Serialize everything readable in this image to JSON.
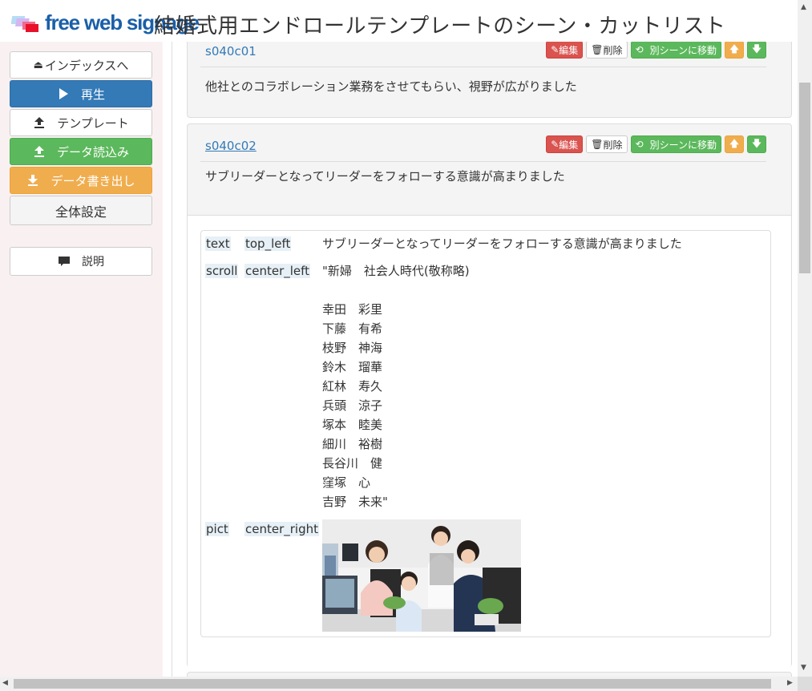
{
  "header": {
    "logo_text": "free web signage",
    "title": "結婚式用エンドロールテンプレートのシーン・カットリスト"
  },
  "sidebar": {
    "index": "インデックスへ",
    "play": "再生",
    "template": "テンプレート",
    "import": "データ読込み",
    "export": "データ書き出し",
    "settings": "全体設定",
    "help": "説明"
  },
  "cut_buttons": {
    "edit": "編集",
    "delete": "削除",
    "move": "別シーンに移動"
  },
  "cuts": [
    {
      "id": "s040c01",
      "text": "他社とのコラボレーション業務をさせてもらい、視野が広がりました"
    },
    {
      "id": "s040c02",
      "text": "サブリーダーとなってリーダーをフォローする意識が高まりました"
    }
  ],
  "detail": {
    "items": [
      {
        "type": "text",
        "position": "top_left",
        "value": "サブリーダーとなってリーダーをフォローする意識が高まりました"
      },
      {
        "type": "scroll",
        "position": "center_left",
        "lines": [
          "\"新婦　社会人時代(敬称略)",
          "",
          "幸田　彩里",
          "下藤　有希",
          "枝野　神海",
          "鈴木　瑠華",
          "紅林　寿久",
          "兵頭　涼子",
          "塚本　睦美",
          "細川　裕樹",
          "長谷川　健",
          "窪塚　心",
          "吉野　未来\""
        ]
      },
      {
        "type": "pict",
        "position": "center_right"
      }
    ]
  }
}
